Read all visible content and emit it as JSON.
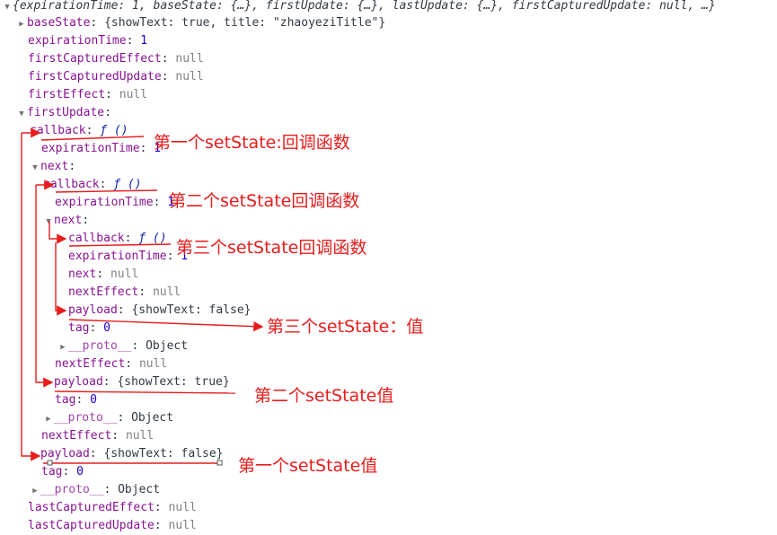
{
  "header": {
    "summary": "{expirationTime: 1, baseState: {…}, firstUpdate: {…}, lastUpdate: {…}, firstCapturedUpdate: null, …}"
  },
  "rows": [
    {
      "key": "baseState",
      "sep": ": ",
      "value": "{showText: true, title: \"zhaoyeziTitle\"}",
      "type": "obj",
      "tri": "right"
    },
    {
      "key": "expirationTime",
      "sep": ": ",
      "value": "1",
      "type": "num",
      "tri": ""
    },
    {
      "key": "firstCapturedEffect",
      "sep": ": ",
      "value": "null",
      "type": "null",
      "tri": ""
    },
    {
      "key": "firstCapturedUpdate",
      "sep": ": ",
      "value": "null",
      "type": "null",
      "tri": ""
    },
    {
      "key": "firstEffect",
      "sep": ": ",
      "value": "null",
      "type": "null",
      "tri": ""
    },
    {
      "key": "firstUpdate",
      "sep": ":",
      "value": "",
      "type": "none",
      "tri": "down"
    },
    {
      "key": "callback",
      "sep": ": ",
      "value": "ƒ ()",
      "type": "fn",
      "tri": ""
    },
    {
      "key": "expirationTime",
      "sep": ": ",
      "value": "1",
      "type": "num",
      "tri": ""
    },
    {
      "key": "next",
      "sep": ":",
      "value": "",
      "type": "none",
      "tri": "down"
    },
    {
      "key": "callback",
      "sep": ": ",
      "value": "ƒ ()",
      "type": "fn",
      "tri": ""
    },
    {
      "key": "expirationTime",
      "sep": ": ",
      "value": "1",
      "type": "num",
      "tri": ""
    },
    {
      "key": "next",
      "sep": ":",
      "value": "",
      "type": "none",
      "tri": "down"
    },
    {
      "key": "callback",
      "sep": ": ",
      "value": "ƒ ()",
      "type": "fn",
      "tri": "right"
    },
    {
      "key": "expirationTime",
      "sep": ": ",
      "value": "1",
      "type": "num",
      "tri": ""
    },
    {
      "key": "next",
      "sep": ": ",
      "value": "null",
      "type": "null",
      "tri": ""
    },
    {
      "key": "nextEffect",
      "sep": ": ",
      "value": "null",
      "type": "null",
      "tri": ""
    },
    {
      "key": "payload",
      "sep": ": ",
      "value": "{showText: false}",
      "type": "obj",
      "tri": "right"
    },
    {
      "key": "tag",
      "sep": ": ",
      "value": "0",
      "type": "num",
      "tri": ""
    },
    {
      "key": "__proto__",
      "sep": ": ",
      "value": "Object",
      "type": "obj",
      "tri": "right"
    },
    {
      "key": "nextEffect",
      "sep": ": ",
      "value": "null",
      "type": "null",
      "tri": ""
    },
    {
      "key": "payload",
      "sep": ": ",
      "value": "{showText: true}",
      "type": "obj",
      "tri": "right"
    },
    {
      "key": "tag",
      "sep": ": ",
      "value": "0",
      "type": "num",
      "tri": ""
    },
    {
      "key": "__proto__",
      "sep": ": ",
      "value": "Object",
      "type": "obj",
      "tri": "right"
    },
    {
      "key": "nextEffect",
      "sep": ": ",
      "value": "null",
      "type": "null",
      "tri": ""
    },
    {
      "key": "payload",
      "sep": ": ",
      "value": "{showText: false}",
      "type": "obj",
      "tri": "right"
    },
    {
      "key": "tag",
      "sep": ": ",
      "value": "0",
      "type": "num",
      "tri": ""
    },
    {
      "key": "__proto__",
      "sep": ": ",
      "value": "Object",
      "type": "obj",
      "tri": "right"
    },
    {
      "key": "lastCapturedEffect",
      "sep": ": ",
      "value": "null",
      "type": "null",
      "tri": ""
    },
    {
      "key": "lastCapturedUpdate",
      "sep": ": ",
      "value": "null",
      "type": "null",
      "tri": ""
    }
  ],
  "annotations": {
    "a1": "第一个setState:回调函数",
    "a2": "第二个setState回调函数",
    "a3": "第三个setState回调函数",
    "a4": "第三个setState：值",
    "a5": "第二个setState值",
    "a6": "第一个setState值"
  },
  "colors": {
    "annotation": "#e81c1c",
    "key": "#881391",
    "number": "#1c00cf",
    "null": "#808080",
    "string": "#c41a16"
  }
}
